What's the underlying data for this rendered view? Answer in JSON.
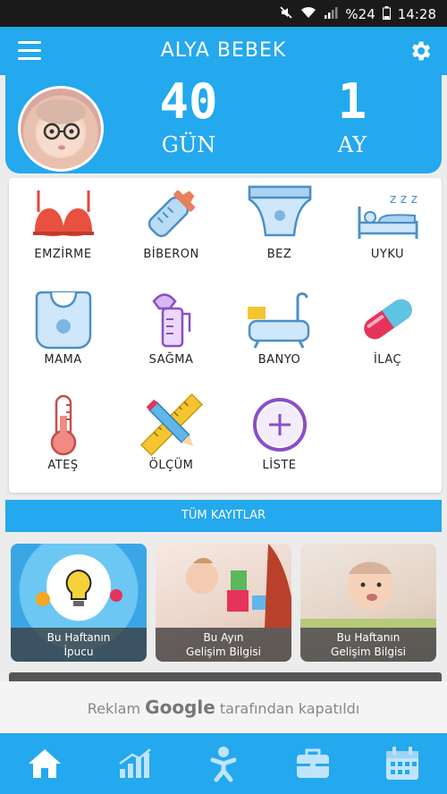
{
  "status_bar": {
    "battery_text": "%24",
    "time": "14:28"
  },
  "app_bar": {
    "title": "ALYA BEBEK",
    "menu_icon": "menu-icon",
    "settings_icon": "gear-icon"
  },
  "hero": {
    "days": {
      "number": "40",
      "unit": "GÜN"
    },
    "months": {
      "number": "1",
      "unit": "AY"
    }
  },
  "activities": [
    {
      "label": "EMZİRME",
      "icon": "bra-icon"
    },
    {
      "label": "BİBERON",
      "icon": "bottle-icon"
    },
    {
      "label": "BEZ",
      "icon": "diaper-icon"
    },
    {
      "label": "UYKU",
      "icon": "sleep-icon"
    },
    {
      "label": "MAMA",
      "icon": "bib-icon"
    },
    {
      "label": "SAĞMA",
      "icon": "breast-pump-icon"
    },
    {
      "label": "BANYO",
      "icon": "bathtub-icon"
    },
    {
      "label": "İLAÇ",
      "icon": "pill-icon"
    },
    {
      "label": "ATEŞ",
      "icon": "thermometer-icon"
    },
    {
      "label": "ÖLÇÜM",
      "icon": "ruler-pencil-icon"
    },
    {
      "label": "LİSTE",
      "icon": "plus-circle-icon"
    }
  ],
  "all_records_label": "TÜM KAYITLAR",
  "cards": [
    {
      "line1": "Bu Haftanın",
      "line2": "İpucu"
    },
    {
      "line1": "Bu Ayın",
      "line2": "Gelişim Bilgisi"
    },
    {
      "line1": "Bu Haftanın",
      "line2": "Gelişim Bilgisi"
    }
  ],
  "ad": {
    "prefix": "Reklam",
    "brand": "Google",
    "suffix": "tarafından kapatıldı"
  },
  "bottom_nav": [
    "home-icon",
    "chart-icon",
    "baby-icon",
    "briefcase-icon",
    "calendar-icon"
  ],
  "colors": {
    "primary": "#24a8ee",
    "active_nav": "#ffffff",
    "inactive_nav": "#bfe4fb"
  }
}
